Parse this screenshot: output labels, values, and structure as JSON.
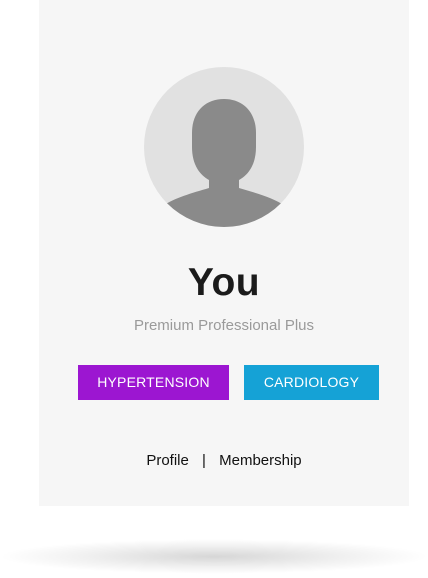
{
  "profile": {
    "name": "You",
    "plan": "Premium Professional Plus",
    "avatar_icon": "user-silhouette-icon"
  },
  "tags": [
    {
      "label": "HYPERTENSION",
      "color": "#9c16d1"
    },
    {
      "label": "CARDIOLOGY",
      "color": "#15a2d6"
    }
  ],
  "links": {
    "profile": "Profile",
    "separator": "|",
    "membership": "Membership"
  },
  "colors": {
    "card_background": "#f6f6f6",
    "avatar_background": "#e1e1e1",
    "avatar_figure": "#8a8a8a"
  }
}
